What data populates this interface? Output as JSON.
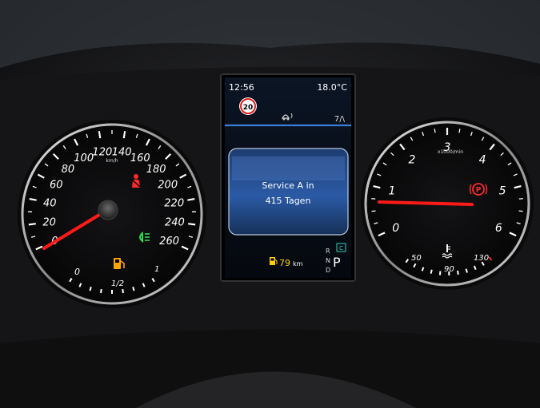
{
  "display": {
    "time": "12:56",
    "temperature": "18.0°C",
    "speed_limit": "20",
    "message_line1": "Service A in",
    "message_line2": "415 Tagen",
    "range_value": "79",
    "range_unit": "km",
    "gear_letters": [
      "R",
      "N",
      "D"
    ],
    "gear_selected": "P",
    "mode_badge": "C",
    "top_right_indicator": "7/\\"
  },
  "speedometer": {
    "labels": [
      "0",
      "20",
      "40",
      "60",
      "80",
      "100",
      "120",
      "140",
      "160",
      "180",
      "200",
      "220",
      "240",
      "260"
    ],
    "unit": "km/h",
    "needle_value": 0
  },
  "fuel_gauge": {
    "labels": [
      "0",
      "1/2",
      "1"
    ]
  },
  "tachometer": {
    "labels": [
      "0",
      "1",
      "2",
      "3",
      "4",
      "5",
      "6"
    ],
    "unit": "x1000/min",
    "needle_value": 0.8
  },
  "coolant_gauge": {
    "labels": [
      "50",
      "90",
      "130"
    ]
  },
  "colors": {
    "needle": "#ff1a1a",
    "warning_red": "#ff2a2a",
    "warning_green": "#28e04a",
    "warning_amber": "#ffa500",
    "display_blue": "#2f66c4"
  },
  "icons": [
    "seatbelt-warning-icon",
    "low-beam-icon",
    "fuel-pump-icon",
    "parking-brake-icon",
    "coolant-temperature-icon",
    "driver-assist-icon",
    "fuel-range-icon"
  ]
}
